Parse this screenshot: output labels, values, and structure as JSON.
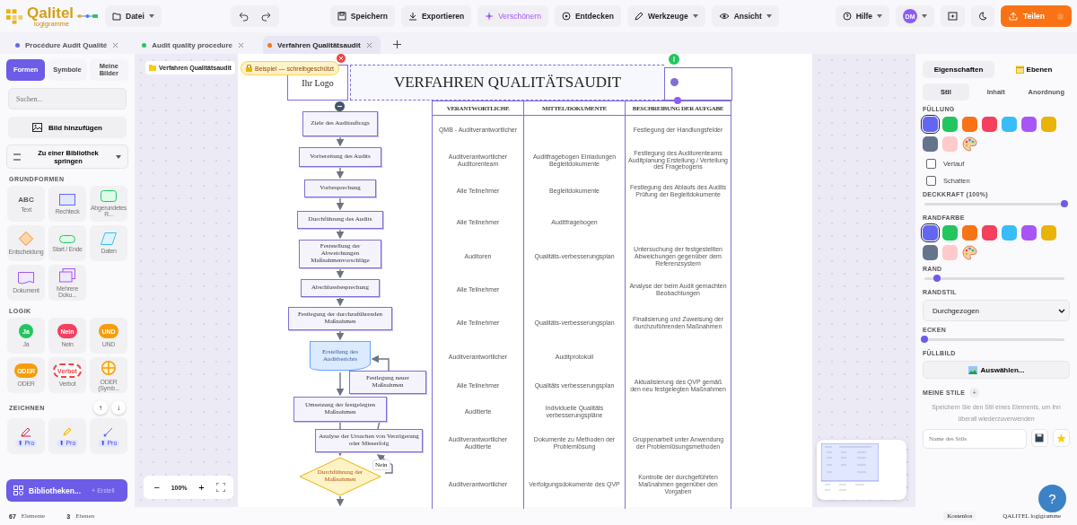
{
  "topbar": {
    "logo": "Qalitel",
    "logo_sub": "logigramme",
    "file": {
      "label": "Datei"
    },
    "save": {
      "label": "Speichern"
    },
    "export": {
      "label": "Exportieren"
    },
    "beautify": {
      "label": "Verschönern"
    },
    "discover": {
      "label": "Entdecken"
    },
    "tools": {
      "label": "Werkzeuge"
    },
    "view": {
      "label": "Ansicht"
    },
    "help": {
      "label": "Hilfe"
    },
    "avatar": {
      "initials": "DM"
    },
    "share": {
      "label": "Teilen"
    }
  },
  "tabs": [
    {
      "label": "Procédure Audit Qualité",
      "color": "#6366f1",
      "selected": false
    },
    {
      "label": "Audit quality procedure",
      "color": "#22c55e",
      "selected": false
    },
    {
      "label": "Verfahren Qualitätsaudit",
      "color": "#f97316",
      "selected": true
    }
  ],
  "sidebar": {
    "tabs": [
      {
        "label": "Formen",
        "selected": true
      },
      {
        "label": "Symbole",
        "selected": false
      },
      {
        "label": "Meine Bilder",
        "selected": false
      }
    ],
    "search": {
      "placeholder": "Suchen..."
    },
    "add_image": "Bild hinzufügen",
    "jump": "Zu einer Bibliothek springen",
    "sections": [
      {
        "title": "GRUNDFORMEN",
        "items": [
          {
            "kind": "text",
            "sample": "ABC",
            "label": "Text"
          },
          {
            "kind": "rect",
            "label": "Rechteck"
          },
          {
            "kind": "rounded",
            "label": "Abgerundetes R..."
          },
          {
            "kind": "diamond",
            "label": "Entscheidung"
          },
          {
            "kind": "pill",
            "label": "Start / Ende"
          },
          {
            "kind": "parallelogram",
            "label": "Daten"
          },
          {
            "kind": "document",
            "label": "Dokument"
          },
          {
            "kind": "stack",
            "label": "Mehrere Doku..."
          }
        ]
      },
      {
        "title": "LOGIK",
        "items": [
          {
            "kind": "badge",
            "sample": "Ja",
            "color": "#22c55e",
            "label": "Ja"
          },
          {
            "kind": "badge",
            "sample": "Nein",
            "color": "#f43f5e",
            "label": "Nein"
          },
          {
            "kind": "badge",
            "sample": "UND",
            "color": "#f59e0b",
            "label": "UND"
          },
          {
            "kind": "badge",
            "sample": "ODER",
            "color": "#f59e0b",
            "label": "ODER"
          },
          {
            "kind": "dashed",
            "sample": "Verbot",
            "color": "#ef4444",
            "label": "Verbot"
          },
          {
            "kind": "cross",
            "color": "#f59e0b",
            "label": "ODER (Symb..."
          }
        ]
      },
      {
        "title": "ZEICHNEN",
        "items": [
          {
            "kind": "pen",
            "pro": "⬆ Pro"
          },
          {
            "kind": "marker",
            "pro": "⬆ Pro"
          },
          {
            "kind": "line",
            "pro": "⬆ Pro"
          }
        ]
      }
    ],
    "scroll_up": "↑",
    "scroll_down": "↓",
    "libraries": "Bibliotheken...",
    "create": "+ Erstell"
  },
  "canvas": {
    "breadcrumb": "Verfahren Qualitätsaudit",
    "readonly": "Beispiel — schreibgeschützt",
    "zoom": "100%",
    "zoom_out": "−",
    "zoom_in": "+",
    "document": {
      "logo": "Ihr Logo",
      "title": "VERFAHREN QUALITÄTSAUDIT",
      "columns": [
        "VERANTWORTLICHE",
        "MITTEL/DOKUMENTE",
        "BESCHREIBUNG DER AUFGABE"
      ],
      "rows": [
        [
          "QMB - Auditverantwortlicher",
          "",
          "Festlegung der Handlungsfelder"
        ],
        [
          "Auditverantwortlicher Auditorenteam",
          "Auditfragebogen Einladungen Begleitdokumente",
          "Festlegung des Auditorenteams Auditplanung Erstellung / Verteilung des Fragebogens"
        ],
        [
          "Alle Teilnehmer",
          "Begleitdokumente",
          "Festlegung des Ablaufs des Audits Prüfung der Begleitdokumente"
        ],
        [
          "Alle Teilnehmer",
          "Auditfragebogen",
          ""
        ],
        [
          "Auditoren",
          "Qualitäts-verbesserungsplan",
          "Untersuchung der festgestellten Abweichungen gegenüber dem Referenzsystem"
        ],
        [
          "Alle Teilnehmer",
          "",
          "Analyse der beim Audit gemachten Beobachtungen"
        ],
        [
          "Alle Teilnehmer",
          "Qualitäts-verbesserungsplan",
          "Finalisierung und Zuweisung der durchzuführenden Maßnahmen"
        ],
        [
          "Auditverantwortlicher",
          "Auditprotokoll",
          ""
        ],
        [
          "Alle Teilnehmer",
          "Qualitäts verbesserungsplan",
          "Aktualisierung des QVP gemäß den neu festgelegten Maßnahmen"
        ],
        [
          "Auditierte",
          "Individuelle Qualitäts verbesserungspläne",
          ""
        ],
        [
          "Auditverantwortlicher Auditierte",
          "Dokumente zu Methoden der Problemlösung",
          "Gruppenarbeit unter Anwendung der Problemlösungsmethoden"
        ],
        [
          "Auditverantwortlicher",
          "Verfolgungsdokumente des QVP",
          "Kontrolle der durchgeführten Maßnahmen gegenüber den Vorgaben"
        ]
      ],
      "nodes": [
        {
          "kind": "process",
          "text": "Ziele des Auditauftrags"
        },
        {
          "kind": "process",
          "text": "Vorbereitung des Audits"
        },
        {
          "kind": "process",
          "text": "Vorbesprechung"
        },
        {
          "kind": "process",
          "text": "Durchführung des Audits"
        },
        {
          "kind": "process",
          "text": "Feststellung der Abweichungen Maßnahmenvorschläge"
        },
        {
          "kind": "process",
          "text": "Abschlussbesprechung"
        },
        {
          "kind": "process",
          "text": "Festlegung der durchzuführenden Maßnahmen"
        },
        {
          "kind": "document",
          "text": "Erstellung des Auditberichts"
        },
        {
          "kind": "process",
          "text": "Festlegung neuer Maßnahmen"
        },
        {
          "kind": "process",
          "text": "Umsetzung der festgelegten Maßnahmen"
        },
        {
          "kind": "process",
          "text": "Analyse der Ursachen von Verzögerung oder Misserfolg"
        },
        {
          "kind": "decision",
          "text": "Durchführung der Maßnahmen"
        }
      ],
      "edge_label": "Nein"
    }
  },
  "properties": {
    "tabs": [
      {
        "label": "Eigenschaften",
        "selected": true
      },
      {
        "label": "Ebenen",
        "selected": false
      }
    ],
    "subtabs": [
      {
        "label": "Stil",
        "selected": true
      },
      {
        "label": "Inhalt",
        "selected": false
      },
      {
        "label": "Anordnung",
        "selected": false
      }
    ],
    "fill": {
      "label": "FÜLLUNG",
      "swatches": [
        {
          "color": "#6366f1",
          "selected": true
        },
        {
          "color": "#22c55e",
          "selected": false
        },
        {
          "color": "#f97316",
          "selected": false
        },
        {
          "color": "#f43f5e",
          "selected": false
        },
        {
          "color": "#38bdf8",
          "selected": false
        },
        {
          "color": "#a855f7",
          "selected": false
        },
        {
          "color": "#eab308",
          "selected": false
        },
        {
          "color": "#64748b",
          "selected": false
        },
        {
          "color": "#fecaca",
          "selected": false
        }
      ]
    },
    "options": [
      {
        "label": "Verlauf",
        "checked": false
      },
      {
        "label": "Schatten",
        "checked": false
      }
    ],
    "opacity": {
      "label": "DECKKRAFT (100%)",
      "level": 1
    },
    "border_color": {
      "label": "RANDFARBE",
      "swatches": [
        {
          "color": "#6366f1",
          "selected": true
        },
        {
          "color": "#22c55e",
          "selected": false
        },
        {
          "color": "#f97316",
          "selected": false
        },
        {
          "color": "#f43f5e",
          "selected": false
        },
        {
          "color": "#38bdf8",
          "selected": false
        },
        {
          "color": "#a855f7",
          "selected": false
        },
        {
          "color": "#eab308",
          "selected": false
        },
        {
          "color": "#64748b",
          "selected": false
        },
        {
          "color": "#fecaca",
          "selected": false
        }
      ]
    },
    "border": {
      "label": "RAND",
      "level": 0.09
    },
    "border_style": {
      "label": "RANDSTIL",
      "value": "Durchgezogen"
    },
    "corners": {
      "label": "ECKEN",
      "level": 0
    },
    "fill_image": {
      "label": "FÜLLBILD",
      "button": "Auswählen..."
    },
    "my_styles": {
      "label": "MEINE STILE",
      "add": "+",
      "hint": "Speichern Sie den Stil eines Elements, um ihn überall wiederzuverwenden",
      "placeholder": "Name des Stils"
    },
    "help": "?"
  },
  "status_bar": {
    "elements_count": "67",
    "elements": "Elemente",
    "layers_count": "3",
    "layers": "Ebenen",
    "plan": "Kostenlos",
    "brand": "QALITEL logigramme"
  }
}
